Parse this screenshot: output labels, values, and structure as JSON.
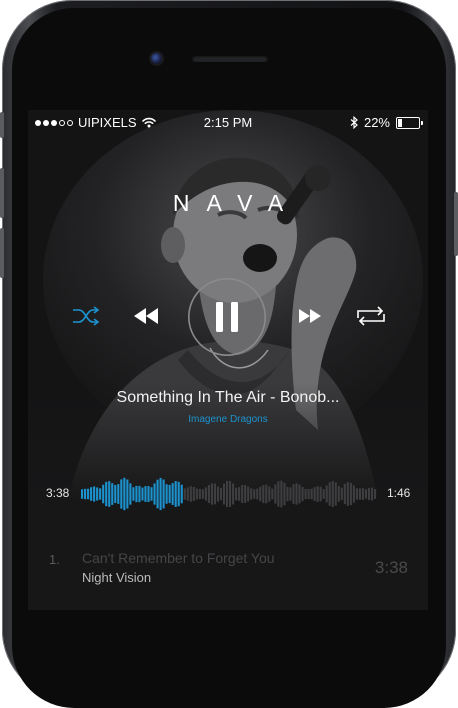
{
  "status": {
    "signal_bars_filled": 3,
    "signal_bars_total": 5,
    "carrier": "UIPIXELS",
    "time": "2:15 PM",
    "battery": "22%",
    "battery_level": 0.22,
    "icons": [
      "wifi-icon",
      "bluetooth-icon",
      "battery-icon"
    ]
  },
  "player": {
    "logo": "NAVA",
    "song_title": "Something In The Air - Bonob...",
    "artist": "Imagene Dragons",
    "elapsed": "3:38",
    "remaining": "1:46",
    "progress": 0.35,
    "controls": [
      "shuffle-icon",
      "rewind-icon",
      "pause-icon",
      "fast-forward-icon",
      "repeat-icon"
    ]
  },
  "playlist": [
    {
      "number": "1.",
      "name": "Can't Remember to Forget You",
      "artist": "Night Vision",
      "duration": "3:38"
    }
  ],
  "colors": {
    "accent": "#1c93cf",
    "screen_bg": "#171718",
    "wave_inactive": "#3e3e40"
  }
}
